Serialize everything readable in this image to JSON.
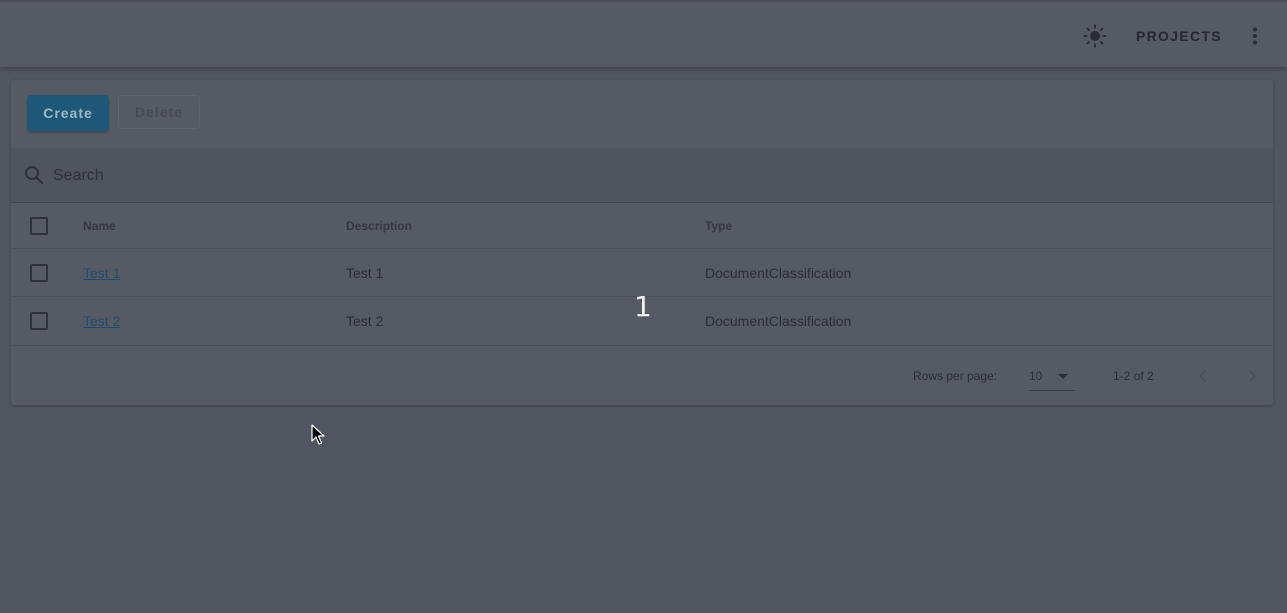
{
  "appbar": {
    "theme_icon": "sun-icon",
    "projects_label": "PROJECTS",
    "menu_icon": "more-vert-icon"
  },
  "toolbar": {
    "create_label": "Create",
    "delete_label": "Delete"
  },
  "search": {
    "placeholder": "Search",
    "icon": "search-icon"
  },
  "table": {
    "headers": {
      "name": "Name",
      "description": "Description",
      "type": "Type"
    },
    "rows": [
      {
        "name": "Test 1",
        "description": "Test 1",
        "type": "DocumentClassification"
      },
      {
        "name": "Test 2",
        "description": "Test 2",
        "type": "DocumentClassification"
      }
    ]
  },
  "pagination": {
    "rows_per_page_label": "Rows per page:",
    "rows_per_page_value": "10",
    "range": "1-2 of 2"
  },
  "overlay": {
    "step_number": "1"
  },
  "colors": {
    "background": "#525660",
    "primary_button": "#1e5778",
    "link": "#1e4d6a"
  }
}
